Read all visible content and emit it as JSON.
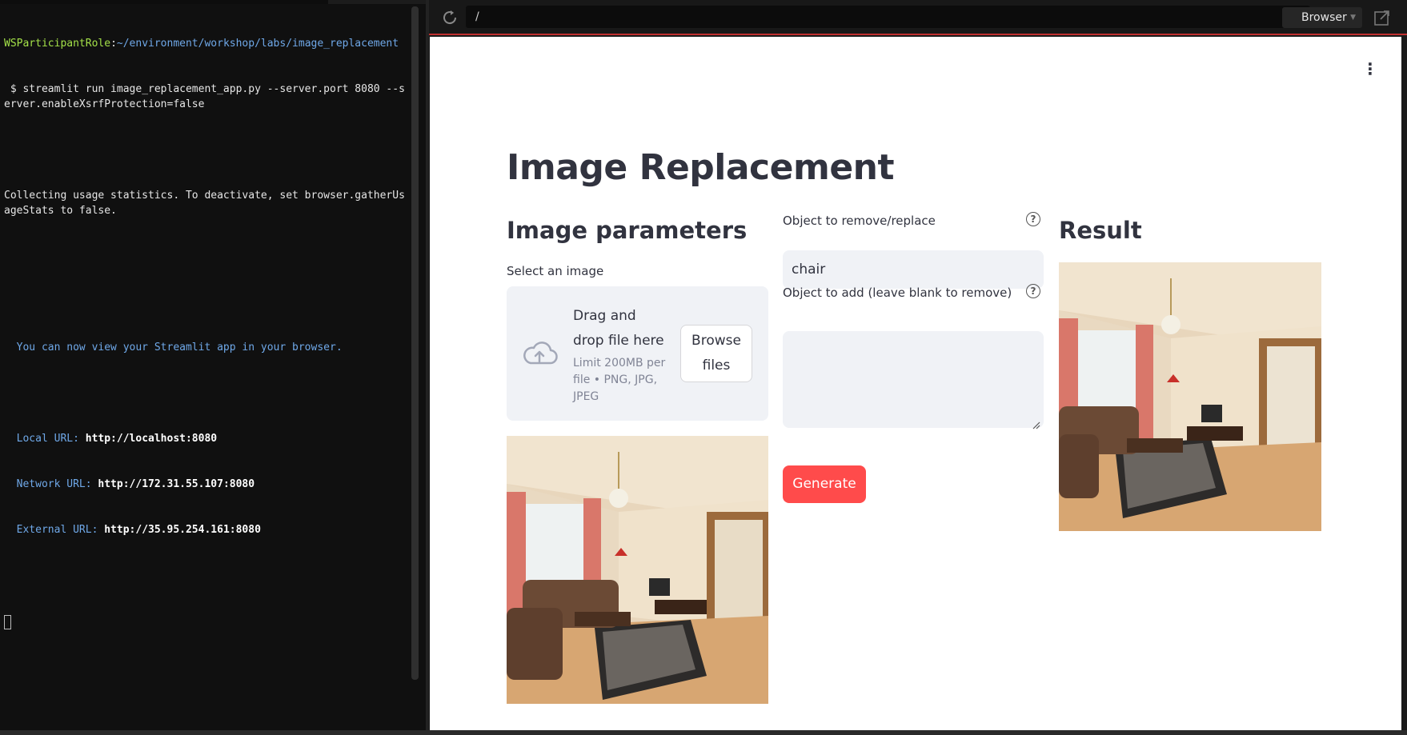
{
  "terminal": {
    "prompt_user": "WSParticipantRole",
    "prompt_sep": ":",
    "prompt_path": "~/environment/workshop/labs/image_replacement",
    "command": " $ streamlit run image_replacement_app.py --server.port 8080 --server.enableXsrfProtection=false",
    "collecting": "Collecting usage statistics. To deactivate, set browser.gatherUsageStats to false.",
    "view_msg": "  You can now view your Streamlit app in your browser.",
    "local_label": "  Local URL: ",
    "local_url": "http://localhost:8080",
    "network_label": "  Network URL: ",
    "network_url": "http://172.31.55.107:8080",
    "external_label": "  External URL: ",
    "external_url": "http://35.95.254.161:8080"
  },
  "browser": {
    "url": "/",
    "button_label": "Browser"
  },
  "app": {
    "title": "Image Replacement",
    "image_params_heading": "Image parameters",
    "select_image_label": "Select an image",
    "drop_main": "Drag and drop file here",
    "drop_limit": "Limit 200MB per file • PNG, JPG, JPEG",
    "browse_label": "Browse files",
    "remove_label": "Object to remove/replace",
    "remove_value": "chair",
    "add_label": "Object to add (leave blank to remove)",
    "add_value": "",
    "generate_label": "Generate",
    "result_heading": "Result",
    "help_glyph": "?"
  },
  "colors": {
    "accent": "#ff4b4b",
    "input_bg": "#f0f2f6",
    "text": "#31333f"
  }
}
